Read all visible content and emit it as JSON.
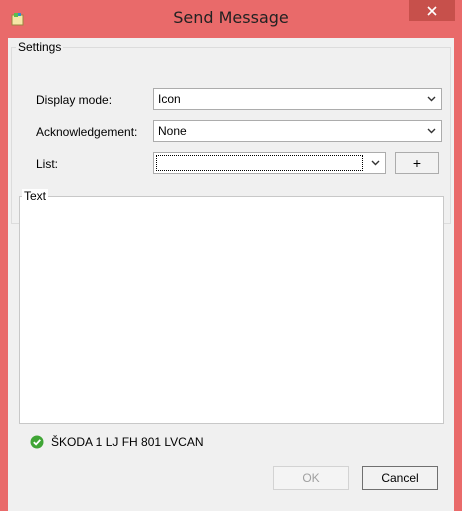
{
  "window": {
    "title": "Send Message",
    "close_icon": "close-icon",
    "app_icon": "window-icon"
  },
  "settings": {
    "group_label": "Settings",
    "display_mode": {
      "label": "Display mode:",
      "value": "Icon"
    },
    "acknowledgement": {
      "label": "Acknowledgement:",
      "value": "None"
    },
    "list": {
      "label": "List:",
      "value": "",
      "add_label": "+"
    }
  },
  "text_group": {
    "label": "Text",
    "value": ""
  },
  "status": {
    "icon": "check-circle-icon",
    "text": "ŠKODA 1 LJ FH 801 LVCAN"
  },
  "buttons": {
    "ok": "OK",
    "cancel": "Cancel"
  },
  "colors": {
    "titlebar": "#e96a6a",
    "close_button": "#c7504b",
    "status_ok": "#3fa535"
  }
}
